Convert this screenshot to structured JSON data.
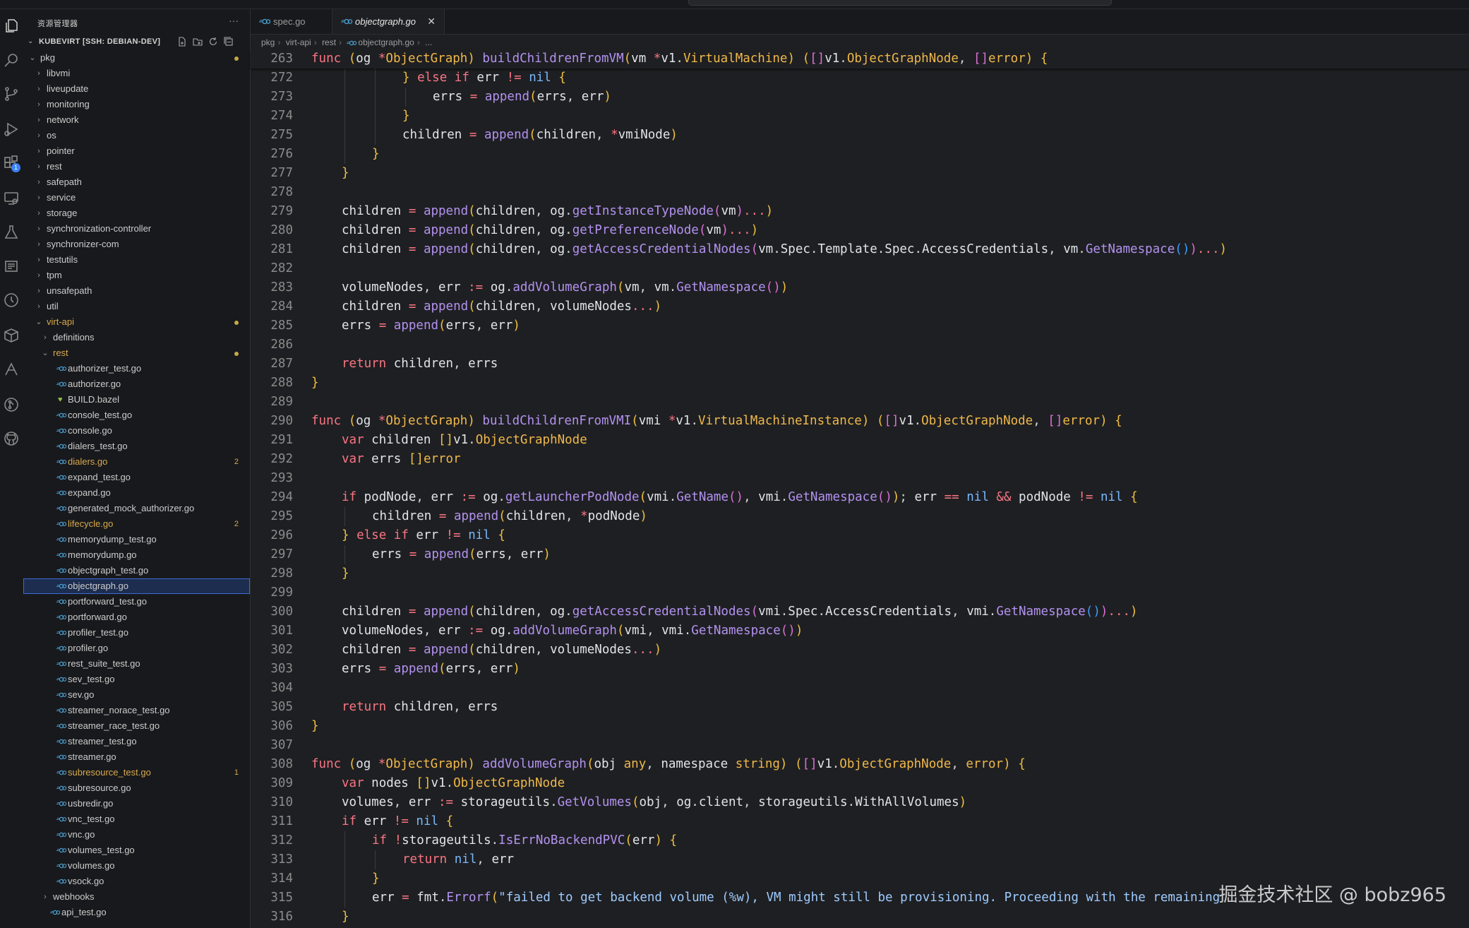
{
  "explorer": {
    "title": "资源管理器",
    "more": "···",
    "section": "KUBEVIRT [SSH: DEBIAN-DEV]"
  },
  "tree": [
    {
      "name": "pkg",
      "depth": 0,
      "type": "folder",
      "open": true,
      "dot": true
    },
    {
      "name": "libvmi",
      "depth": 1,
      "type": "folder"
    },
    {
      "name": "liveupdate",
      "depth": 1,
      "type": "folder"
    },
    {
      "name": "monitoring",
      "depth": 1,
      "type": "folder"
    },
    {
      "name": "network",
      "depth": 1,
      "type": "folder"
    },
    {
      "name": "os",
      "depth": 1,
      "type": "folder"
    },
    {
      "name": "pointer",
      "depth": 1,
      "type": "folder"
    },
    {
      "name": "rest",
      "depth": 1,
      "type": "folder"
    },
    {
      "name": "safepath",
      "depth": 1,
      "type": "folder"
    },
    {
      "name": "service",
      "depth": 1,
      "type": "folder"
    },
    {
      "name": "storage",
      "depth": 1,
      "type": "folder"
    },
    {
      "name": "synchronization-controller",
      "depth": 1,
      "type": "folder"
    },
    {
      "name": "synchronizer-com",
      "depth": 1,
      "type": "folder"
    },
    {
      "name": "testutils",
      "depth": 1,
      "type": "folder"
    },
    {
      "name": "tpm",
      "depth": 1,
      "type": "folder"
    },
    {
      "name": "unsafepath",
      "depth": 1,
      "type": "folder"
    },
    {
      "name": "util",
      "depth": 1,
      "type": "folder"
    },
    {
      "name": "virt-api",
      "depth": 1,
      "type": "folder",
      "open": true,
      "dot": true,
      "mod": true
    },
    {
      "name": "definitions",
      "depth": 2,
      "type": "folder"
    },
    {
      "name": "rest",
      "depth": 2,
      "type": "folder",
      "open": true,
      "dot": true,
      "mod": true
    },
    {
      "name": "authorizer_test.go",
      "depth": 3,
      "type": "go"
    },
    {
      "name": "authorizer.go",
      "depth": 3,
      "type": "go"
    },
    {
      "name": "BUILD.bazel",
      "depth": 3,
      "type": "bazel"
    },
    {
      "name": "console_test.go",
      "depth": 3,
      "type": "go"
    },
    {
      "name": "console.go",
      "depth": 3,
      "type": "go"
    },
    {
      "name": "dialers_test.go",
      "depth": 3,
      "type": "go"
    },
    {
      "name": "dialers.go",
      "depth": 3,
      "type": "go",
      "mod": true,
      "count": "2"
    },
    {
      "name": "expand_test.go",
      "depth": 3,
      "type": "go"
    },
    {
      "name": "expand.go",
      "depth": 3,
      "type": "go"
    },
    {
      "name": "generated_mock_authorizer.go",
      "depth": 3,
      "type": "go"
    },
    {
      "name": "lifecycle.go",
      "depth": 3,
      "type": "go",
      "mod": true,
      "count": "2"
    },
    {
      "name": "memorydump_test.go",
      "depth": 3,
      "type": "go"
    },
    {
      "name": "memorydump.go",
      "depth": 3,
      "type": "go"
    },
    {
      "name": "objectgraph_test.go",
      "depth": 3,
      "type": "go"
    },
    {
      "name": "objectgraph.go",
      "depth": 3,
      "type": "go",
      "selected": true
    },
    {
      "name": "portforward_test.go",
      "depth": 3,
      "type": "go"
    },
    {
      "name": "portforward.go",
      "depth": 3,
      "type": "go"
    },
    {
      "name": "profiler_test.go",
      "depth": 3,
      "type": "go"
    },
    {
      "name": "profiler.go",
      "depth": 3,
      "type": "go"
    },
    {
      "name": "rest_suite_test.go",
      "depth": 3,
      "type": "go"
    },
    {
      "name": "sev_test.go",
      "depth": 3,
      "type": "go"
    },
    {
      "name": "sev.go",
      "depth": 3,
      "type": "go"
    },
    {
      "name": "streamer_norace_test.go",
      "depth": 3,
      "type": "go"
    },
    {
      "name": "streamer_race_test.go",
      "depth": 3,
      "type": "go"
    },
    {
      "name": "streamer_test.go",
      "depth": 3,
      "type": "go"
    },
    {
      "name": "streamer.go",
      "depth": 3,
      "type": "go"
    },
    {
      "name": "subresource_test.go",
      "depth": 3,
      "type": "go",
      "mod": true,
      "count": "1"
    },
    {
      "name": "subresource.go",
      "depth": 3,
      "type": "go"
    },
    {
      "name": "usbredir.go",
      "depth": 3,
      "type": "go"
    },
    {
      "name": "vnc_test.go",
      "depth": 3,
      "type": "go"
    },
    {
      "name": "vnc.go",
      "depth": 3,
      "type": "go"
    },
    {
      "name": "volumes_test.go",
      "depth": 3,
      "type": "go"
    },
    {
      "name": "volumes.go",
      "depth": 3,
      "type": "go"
    },
    {
      "name": "vsock.go",
      "depth": 3,
      "type": "go"
    },
    {
      "name": "webhooks",
      "depth": 2,
      "type": "folder"
    },
    {
      "name": "api_test.go",
      "depth": 2,
      "type": "go"
    }
  ],
  "tabs": [
    {
      "name": "spec.go",
      "active": false
    },
    {
      "name": "objectgraph.go",
      "active": true
    }
  ],
  "breadcrumb": [
    "pkg",
    "virt-api",
    "rest",
    "objectgraph.go",
    "..."
  ],
  "colors": {
    "keyword": "#f97583",
    "type": "#f0b849",
    "function": "#b392f0",
    "literal": "#79b8ff",
    "string": "#9ecbff",
    "accent": "#3d6ad6",
    "modified": "#d7a94e",
    "go_icon": "#4aa3d8"
  },
  "code": [
    {
      "n": "263",
      "sticky": true,
      "t": "func (og *ObjectGraph) buildChildrenFromVM(vm *v1.VirtualMachine) ([]v1.ObjectGraphNode, []error) {"
    },
    {
      "n": "272",
      "t": "\t\t\t} else if err != nil {"
    },
    {
      "n": "273",
      "t": "\t\t\t\terrs = append(errs, err)"
    },
    {
      "n": "274",
      "t": "\t\t\t}"
    },
    {
      "n": "275",
      "t": "\t\t\tchildren = append(children, *vmiNode)"
    },
    {
      "n": "276",
      "t": "\t\t}"
    },
    {
      "n": "277",
      "t": "\t}"
    },
    {
      "n": "278",
      "t": ""
    },
    {
      "n": "279",
      "t": "\tchildren = append(children, og.getInstanceTypeNode(vm)...)"
    },
    {
      "n": "280",
      "t": "\tchildren = append(children, og.getPreferenceNode(vm)...)"
    },
    {
      "n": "281",
      "t": "\tchildren = append(children, og.getAccessCredentialNodes(vm.Spec.Template.Spec.AccessCredentials, vm.GetNamespace())...)"
    },
    {
      "n": "282",
      "t": ""
    },
    {
      "n": "283",
      "t": "\tvolumeNodes, err := og.addVolumeGraph(vm, vm.GetNamespace())"
    },
    {
      "n": "284",
      "t": "\tchildren = append(children, volumeNodes...)"
    },
    {
      "n": "285",
      "t": "\terrs = append(errs, err)"
    },
    {
      "n": "286",
      "t": ""
    },
    {
      "n": "287",
      "t": "\treturn children, errs"
    },
    {
      "n": "288",
      "t": "}"
    },
    {
      "n": "289",
      "t": ""
    },
    {
      "n": "290",
      "t": "func (og *ObjectGraph) buildChildrenFromVMI(vmi *v1.VirtualMachineInstance) ([]v1.ObjectGraphNode, []error) {"
    },
    {
      "n": "291",
      "t": "\tvar children []v1.ObjectGraphNode"
    },
    {
      "n": "292",
      "t": "\tvar errs []error"
    },
    {
      "n": "293",
      "t": ""
    },
    {
      "n": "294",
      "t": "\tif podNode, err := og.getLauncherPodNode(vmi.GetName(), vmi.GetNamespace()); err == nil && podNode != nil {"
    },
    {
      "n": "295",
      "t": "\t\tchildren = append(children, *podNode)"
    },
    {
      "n": "296",
      "t": "\t} else if err != nil {"
    },
    {
      "n": "297",
      "t": "\t\terrs = append(errs, err)"
    },
    {
      "n": "298",
      "t": "\t}"
    },
    {
      "n": "299",
      "t": ""
    },
    {
      "n": "300",
      "t": "\tchildren = append(children, og.getAccessCredentialNodes(vmi.Spec.AccessCredentials, vmi.GetNamespace())...)"
    },
    {
      "n": "301",
      "t": "\tvolumeNodes, err := og.addVolumeGraph(vmi, vmi.GetNamespace())"
    },
    {
      "n": "302",
      "t": "\tchildren = append(children, volumeNodes...)"
    },
    {
      "n": "303",
      "t": "\terrs = append(errs, err)"
    },
    {
      "n": "304",
      "t": ""
    },
    {
      "n": "305",
      "t": "\treturn children, errs"
    },
    {
      "n": "306",
      "t": "}"
    },
    {
      "n": "307",
      "t": ""
    },
    {
      "n": "308",
      "t": "func (og *ObjectGraph) addVolumeGraph(obj any, namespace string) ([]v1.ObjectGraphNode, error) {"
    },
    {
      "n": "309",
      "t": "\tvar nodes []v1.ObjectGraphNode"
    },
    {
      "n": "310",
      "t": "\tvolumes, err := storageutils.GetVolumes(obj, og.client, storageutils.WithAllVolumes)"
    },
    {
      "n": "311",
      "t": "\tif err != nil {"
    },
    {
      "n": "312",
      "t": "\t\tif !storageutils.IsErrNoBackendPVC(err) {"
    },
    {
      "n": "313",
      "t": "\t\t\treturn nil, err"
    },
    {
      "n": "314",
      "t": "\t\t}"
    },
    {
      "n": "315",
      "t": "\t\terr = fmt.Errorf(\"failed to get backend volume (%w), VM might still be provisioning. Proceeding with the remaining"
    },
    {
      "n": "316",
      "t": "\t}"
    }
  ],
  "watermark": "掘金技术社区 @ bobz965"
}
